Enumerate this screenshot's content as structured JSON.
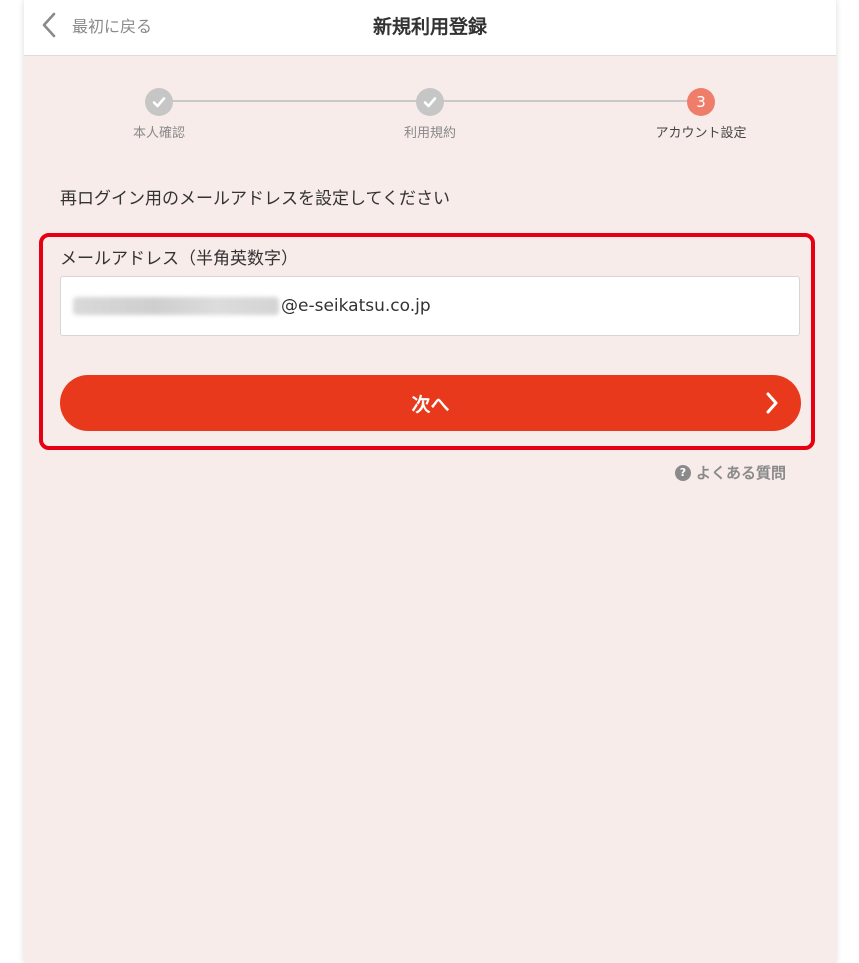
{
  "header": {
    "back_label": "最初に戻る",
    "title": "新規利用登録"
  },
  "stepper": {
    "steps": [
      {
        "label": "本人確認",
        "state": "done"
      },
      {
        "label": "利用規約",
        "state": "done"
      },
      {
        "label": "アカウント設定",
        "state": "active",
        "number": "3"
      }
    ]
  },
  "form": {
    "instruction": "再ログイン用のメールアドレスを設定してください",
    "email_label": "メールアドレス（半角英数字）",
    "email_domain": "@e-seikatsu.co.jp",
    "next_label": "次へ"
  },
  "faq": {
    "label": "よくある質問",
    "icon_glyph": "?"
  },
  "colors": {
    "accent": "#e8391c",
    "step_active": "#ee7e69",
    "step_done": "#c6c6c6",
    "background": "#f8ecea",
    "highlight": "#e60012"
  }
}
